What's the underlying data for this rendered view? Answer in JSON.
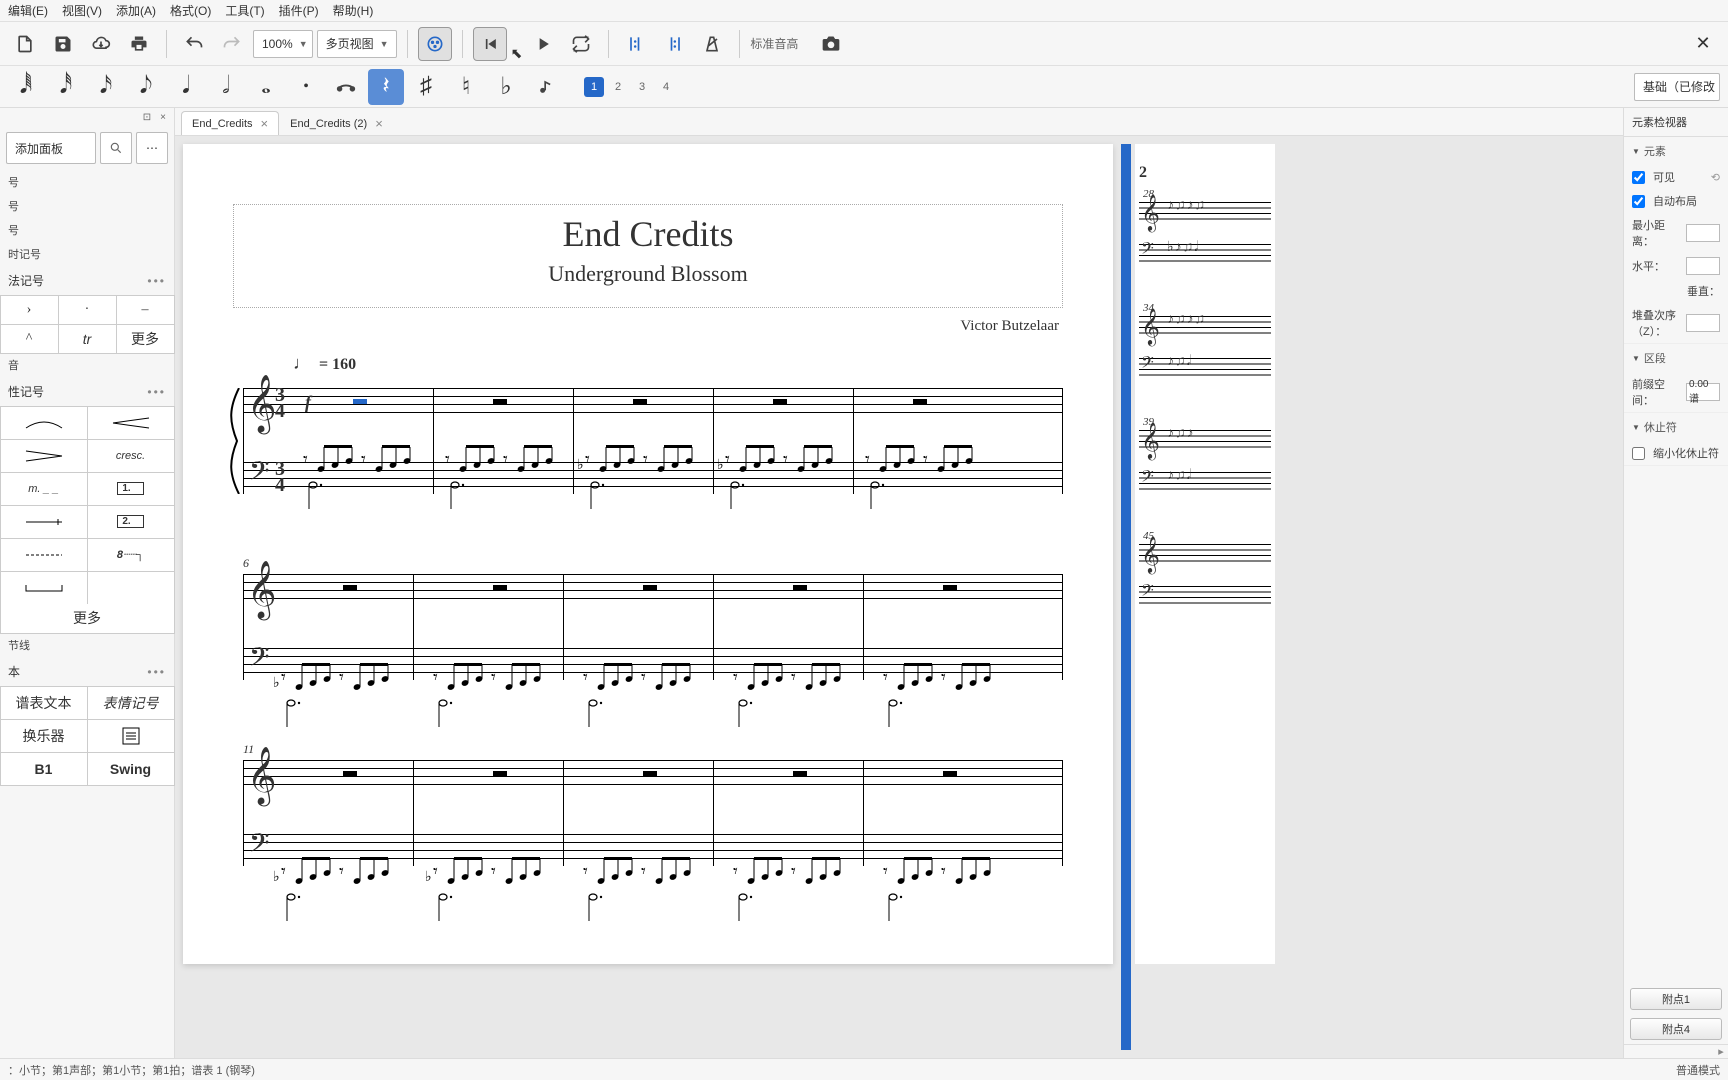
{
  "menu": {
    "edit": "编辑(E)",
    "view": "视图(V)",
    "add": "添加(A)",
    "format": "格式(O)",
    "tools": "工具(T)",
    "plugins": "插件(P)",
    "help": "帮助(H)"
  },
  "toolbar1": {
    "zoom": "100%",
    "view_mode": "多页视图",
    "pitch_label": "标准音高"
  },
  "toolbar2": {
    "voices": [
      "1",
      "2",
      "3",
      "4"
    ],
    "right": "基础（已修改"
  },
  "left": {
    "add_panel": "添加面板",
    "sections": {
      "clef": "号",
      "key": "号",
      "time": "号",
      "tempo": "时记号",
      "tech": "法记号",
      "dyn": "音",
      "line": "性记号",
      "bar": "节线",
      "text": "本",
      "staff": "谱表文本",
      "expr": "表情记号",
      "instc": "换乐器",
      "b1": "B1",
      "swing": "Swing"
    },
    "more": "更多",
    "cresc": "cresc."
  },
  "tabs": {
    "t1": "End_Credits",
    "t2": "End_Credits  (2)"
  },
  "score": {
    "title": "End Credits",
    "subtitle": "Underground Blossom",
    "composer": "Victor Butzelaar",
    "tempo": " = 160",
    "timesig_top": "3",
    "timesig_bot": "4",
    "dyn": "f",
    "meas6": "6",
    "meas11": "11",
    "p2": "2",
    "m28": "28",
    "m34": "34",
    "m39": "39",
    "m45": "45"
  },
  "inspector": {
    "title": "元素检视器",
    "sec_element": "元素",
    "visible": "可见",
    "auto": "自动布局",
    "mindist": "最小距离：",
    "horiz": "水平：",
    "vert": "垂直：",
    "stack": "堆叠次序（Z）：",
    "sec_segment": "区段",
    "prefix": "前缀空间：",
    "prefix_val": "0.00谱",
    "sec_rest": "休止符",
    "smallrest": "缩小化休止符",
    "attach1": "附点1",
    "attach4": "附点4"
  },
  "status": {
    "left": "：小节；第1声部；第1小节；第1拍；谱表 1 (钢琴)",
    "right": "普通模式"
  }
}
